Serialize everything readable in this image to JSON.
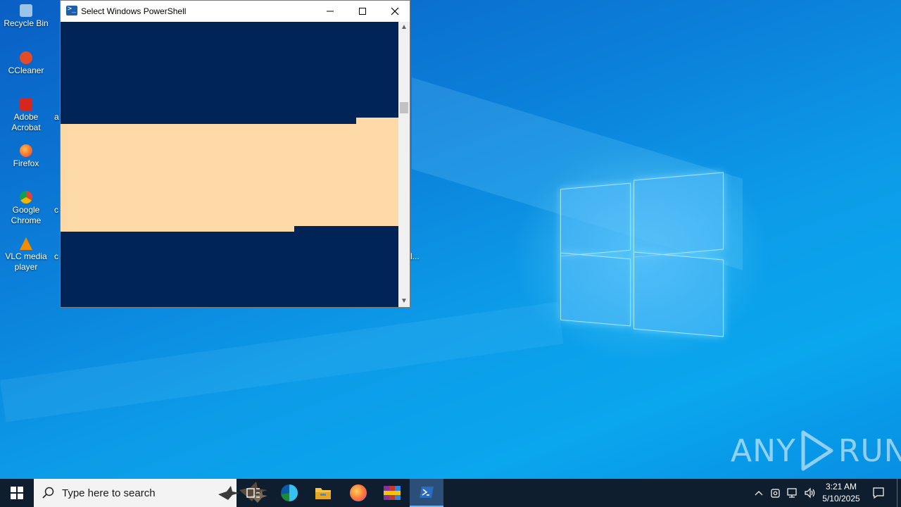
{
  "desktop": {
    "icons": [
      {
        "label": "Recycle Bin",
        "icon": "recycle-bin-icon"
      },
      {
        "label": "CCleaner",
        "icon": "ccleaner-icon"
      },
      {
        "label": "Adobe Acrobat",
        "icon": "adobe-acrobat-icon"
      },
      {
        "label": "Firefox",
        "icon": "firefox-icon"
      },
      {
        "label": "Google Chrome",
        "icon": "google-chrome-icon"
      },
      {
        "label": "VLC media player",
        "icon": "vlc-icon"
      }
    ],
    "partial_labels": [
      "a",
      "c",
      "c",
      "l..."
    ]
  },
  "window": {
    "title": "Select Windows PowerShell",
    "icon": "powershell-icon",
    "minimize_icon": "minimize-icon",
    "maximize_icon": "maximize-icon",
    "close_icon": "close-icon",
    "console_bg": "#012456",
    "selection_color": "#fdd9a7"
  },
  "watermark": {
    "left": "ANY",
    "right": "RUN"
  },
  "taskbar": {
    "search_placeholder": "Type here to search",
    "apps": [
      {
        "name": "task-view",
        "icon": "task-view-icon"
      },
      {
        "name": "edge",
        "icon": "edge-icon"
      },
      {
        "name": "file-explorer",
        "icon": "folder-icon"
      },
      {
        "name": "firefox",
        "icon": "firefox-icon"
      },
      {
        "name": "winrar",
        "icon": "winrar-icon"
      },
      {
        "name": "powershell",
        "icon": "powershell-icon",
        "active": true
      }
    ],
    "clock": {
      "time": "3:21 AM",
      "date": "5/10/2025"
    }
  },
  "colors": {
    "taskbar": "#0f1e2e",
    "active_app": "#2c4f7a",
    "wallpaper_blue": "#0b7fd9"
  }
}
